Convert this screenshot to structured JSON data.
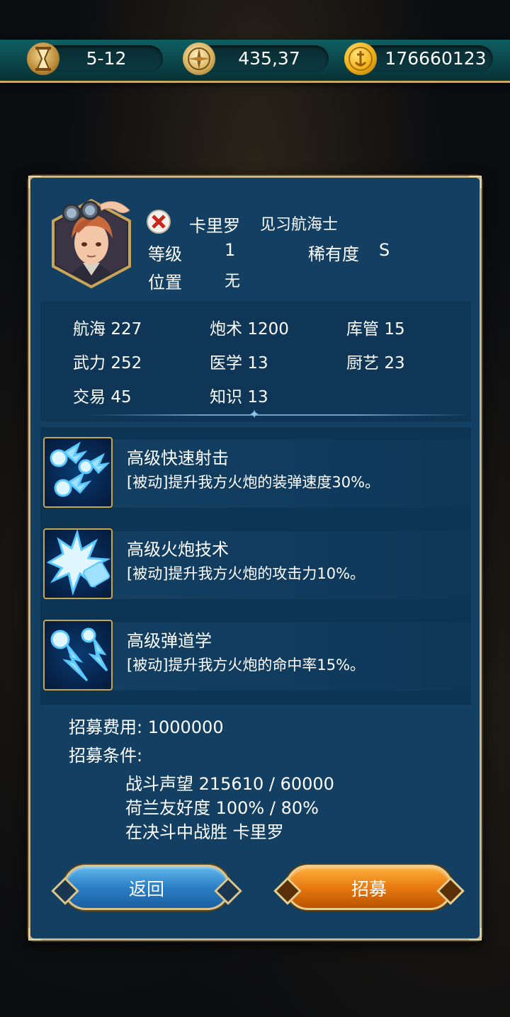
{
  "topbar": {
    "date": "5-12",
    "coords": "435,37",
    "gold": "176660123",
    "icons": [
      "hourglass-icon",
      "compass-icon",
      "gold-coin-icon"
    ]
  },
  "character": {
    "name": "卡里罗",
    "title": "见习航海士",
    "level_label": "等级",
    "level": "1",
    "rarity_label": "稀有度",
    "rarity": "S",
    "position_label": "位置",
    "position": "无"
  },
  "stats": [
    {
      "label": "航海",
      "value": "227"
    },
    {
      "label": "炮术",
      "value": "1200"
    },
    {
      "label": "库管",
      "value": "15"
    },
    {
      "label": "武力",
      "value": "252"
    },
    {
      "label": "医学",
      "value": "13"
    },
    {
      "label": "厨艺",
      "value": "23"
    },
    {
      "label": "交易",
      "value": "45"
    },
    {
      "label": "知识",
      "value": "13"
    }
  ],
  "skills": [
    {
      "name": "高级快速射击",
      "desc": "[被动]提升我方火炮的装弹速度30%。"
    },
    {
      "name": "高级火炮技术",
      "desc": "[被动]提升我方火炮的攻击力10%。"
    },
    {
      "name": "高级弹道学",
      "desc": "[被动]提升我方火炮的命中率15%。"
    }
  ],
  "recruit": {
    "cost_label": "招募费用: 1000000",
    "conditions_label": "招募条件:",
    "conditions": [
      "战斗声望 215610 / 60000",
      "荷兰友好度 100% / 80%",
      "在决斗中战胜  卡里罗"
    ]
  },
  "buttons": {
    "back": "返回",
    "recruit": "招募"
  },
  "colors": {
    "panel": "#133f62",
    "frame": "#c8b48a",
    "back_button": "#2b7fc6",
    "recruit_button": "#e87a10",
    "topbar": "#0a4347"
  }
}
